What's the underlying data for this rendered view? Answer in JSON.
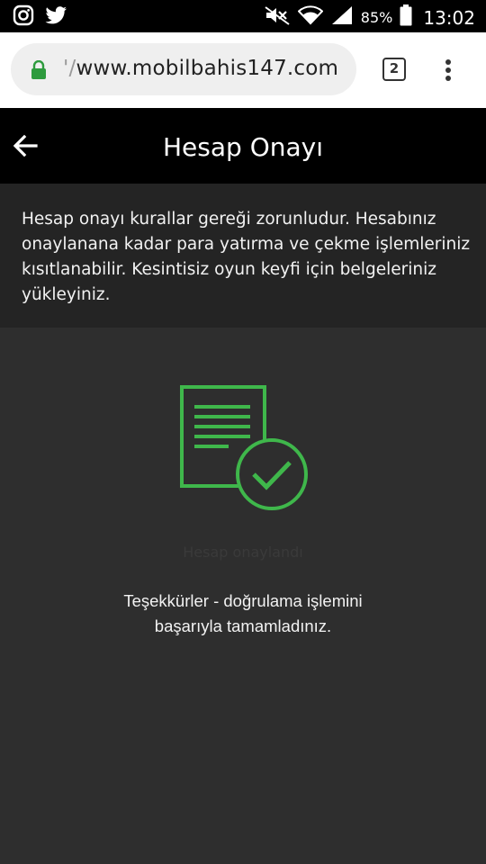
{
  "status_bar": {
    "battery_percent": "85%",
    "time": "13:02",
    "icons": [
      "instagram-icon",
      "twitter-icon",
      "mute-icon",
      "wifi-icon",
      "signal-icon",
      "battery-icon"
    ]
  },
  "browser": {
    "url_scheme_fragment": "'/",
    "url_host": "www.mobilbahis147.com",
    "tab_count": "2"
  },
  "header": {
    "title": "Hesap Onayı"
  },
  "info": {
    "text": "Hesap onayı kurallar gereği zorunludur. Hesabınız onaylanana kadar para yatırma ve çekme işlemleriniz kısıtlanabilir. Kesintisiz oyun keyfi için belgeleriniz yükleyiniz."
  },
  "content": {
    "faded_label": "Hesap onaylandı",
    "thanks_line1": "Teşekkürler - doğrulama işlemini",
    "thanks_line2": "başarıyla tamamladınız."
  },
  "colors": {
    "accent_green": "#3fb74b",
    "background": "#2e2e2e",
    "panel": "#242424",
    "header": "#000000"
  }
}
